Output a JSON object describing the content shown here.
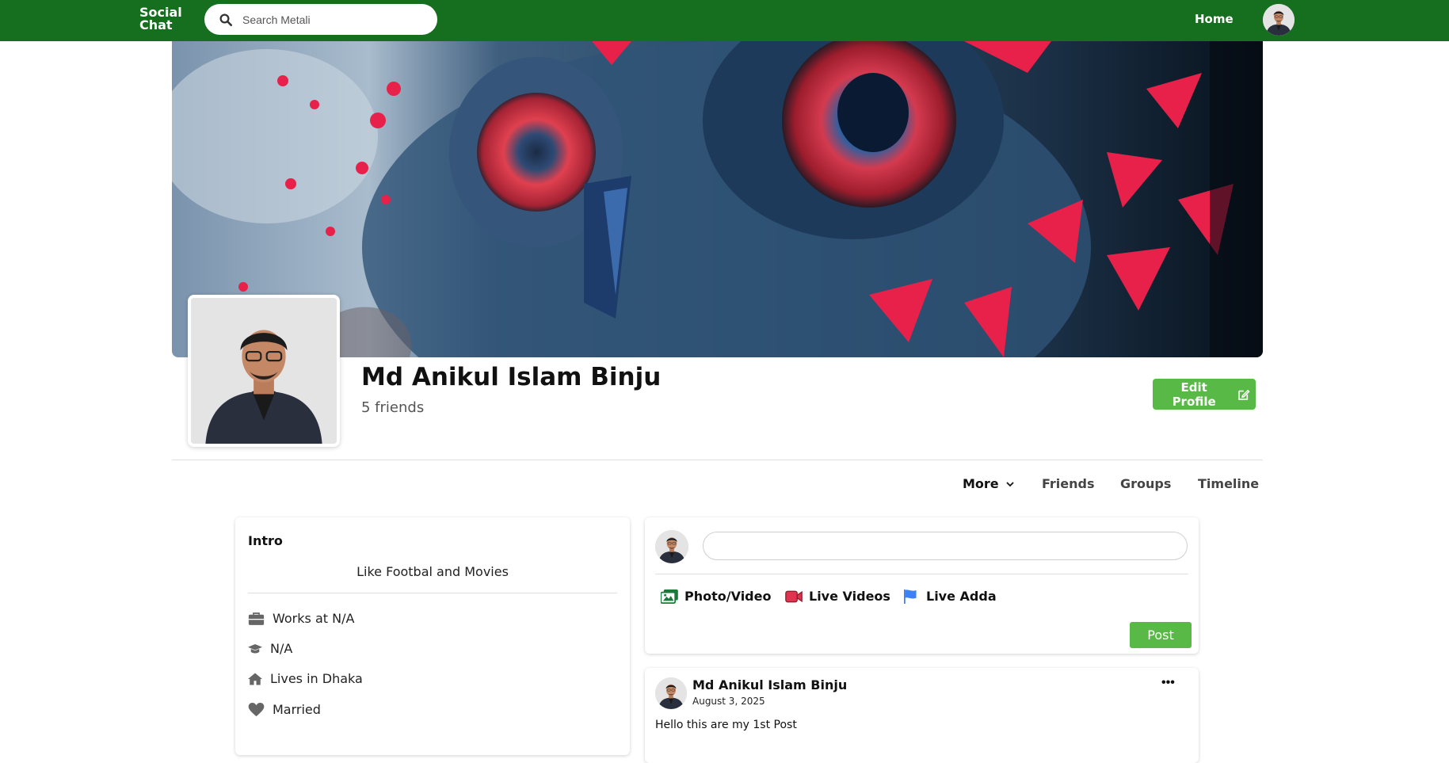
{
  "header": {
    "brand_line1": "Social",
    "brand_line2": "Chat",
    "search_placeholder": "Search Metali",
    "home_label": "Home"
  },
  "profile": {
    "name": "Md Anikul Islam Binju",
    "friends_text": "5 friends",
    "edit_label": "Edit Profile"
  },
  "tabs": {
    "more": "More",
    "friends": "Friends",
    "groups": "Groups",
    "timeline": "Timeline"
  },
  "intro": {
    "title": "Intro",
    "bio": "Like Footbal and Movies",
    "work": "Works at N/A",
    "education": "N/A",
    "lives": "Lives in Dhaka",
    "relationship": "Married"
  },
  "composer": {
    "input_value": "",
    "photo_label": "Photo/Video",
    "live_videos_label": "Live Videos",
    "live_adda_label": "Live Adda",
    "post_label": "Post"
  },
  "post": {
    "author": "Md Anikul Islam Binju",
    "date": "August 3, 2025",
    "menu": "•••",
    "text": "Hello this are my 1st Post"
  },
  "colors": {
    "topbar": "#166e1f",
    "accent_green": "#58b946",
    "live_video_red": "#e0334f",
    "flag_blue": "#3b82f6"
  },
  "icons": [
    "search-icon",
    "avatar",
    "edit-icon",
    "chevron-down-icon",
    "briefcase-icon",
    "graduation-cap-icon",
    "home-icon",
    "heart-icon",
    "photo-icon",
    "video-icon",
    "flag-icon",
    "ellipsis-icon"
  ]
}
